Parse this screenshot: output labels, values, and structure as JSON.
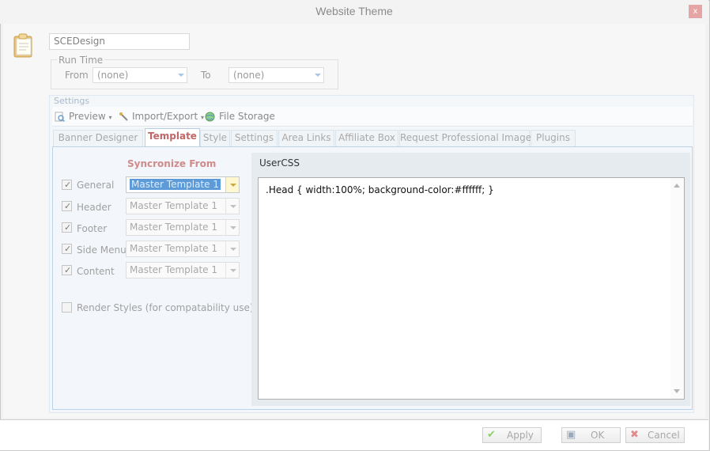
{
  "window": {
    "title": "Website Theme",
    "close_glyph": "x"
  },
  "theme_name": "SCEDesign",
  "run_time": {
    "label": "Run Time",
    "from_label": "From",
    "from_value": "(none)",
    "to_label": "To",
    "to_value": "(none)"
  },
  "settings": {
    "label": "Settings",
    "toolbar": {
      "preview": "Preview",
      "import_export": "Import/Export",
      "file_storage": "File Storage"
    },
    "tabs": [
      {
        "label": "Banner Designer",
        "active": false
      },
      {
        "label": "Template",
        "active": true
      },
      {
        "label": "Style",
        "active": false
      },
      {
        "label": "Settings",
        "active": false
      },
      {
        "label": "Area Links",
        "active": false
      },
      {
        "label": "Affiliate Box",
        "active": false
      },
      {
        "label": "Request Professional Images",
        "active": false
      },
      {
        "label": "Plugins",
        "active": false
      }
    ]
  },
  "template": {
    "sync_title": "Syncronize From",
    "rows": [
      {
        "label": "General",
        "checked": true,
        "value": "Master Template 1",
        "selected": true
      },
      {
        "label": "Header",
        "checked": true,
        "value": "Master Template 1",
        "selected": false
      },
      {
        "label": "Footer",
        "checked": true,
        "value": "Master Template 1",
        "selected": false
      },
      {
        "label": "Side Menu",
        "checked": true,
        "value": "Master Template 1",
        "selected": false
      },
      {
        "label": "Content",
        "checked": true,
        "value": "Master Template 1",
        "selected": false
      }
    ],
    "render_styles": {
      "label": "Render Styles (for compatability use)",
      "checked": false
    },
    "user_css_label": "UserCSS",
    "user_css": ".Head { width:100%; background-color:#ffffff; }"
  },
  "footer": {
    "apply": "Apply",
    "ok": "OK",
    "cancel": "Cancel"
  },
  "colors": {
    "active_tab": "#c06666",
    "selection": "#5d9bd8",
    "panel_border": "#b9d4ea"
  }
}
